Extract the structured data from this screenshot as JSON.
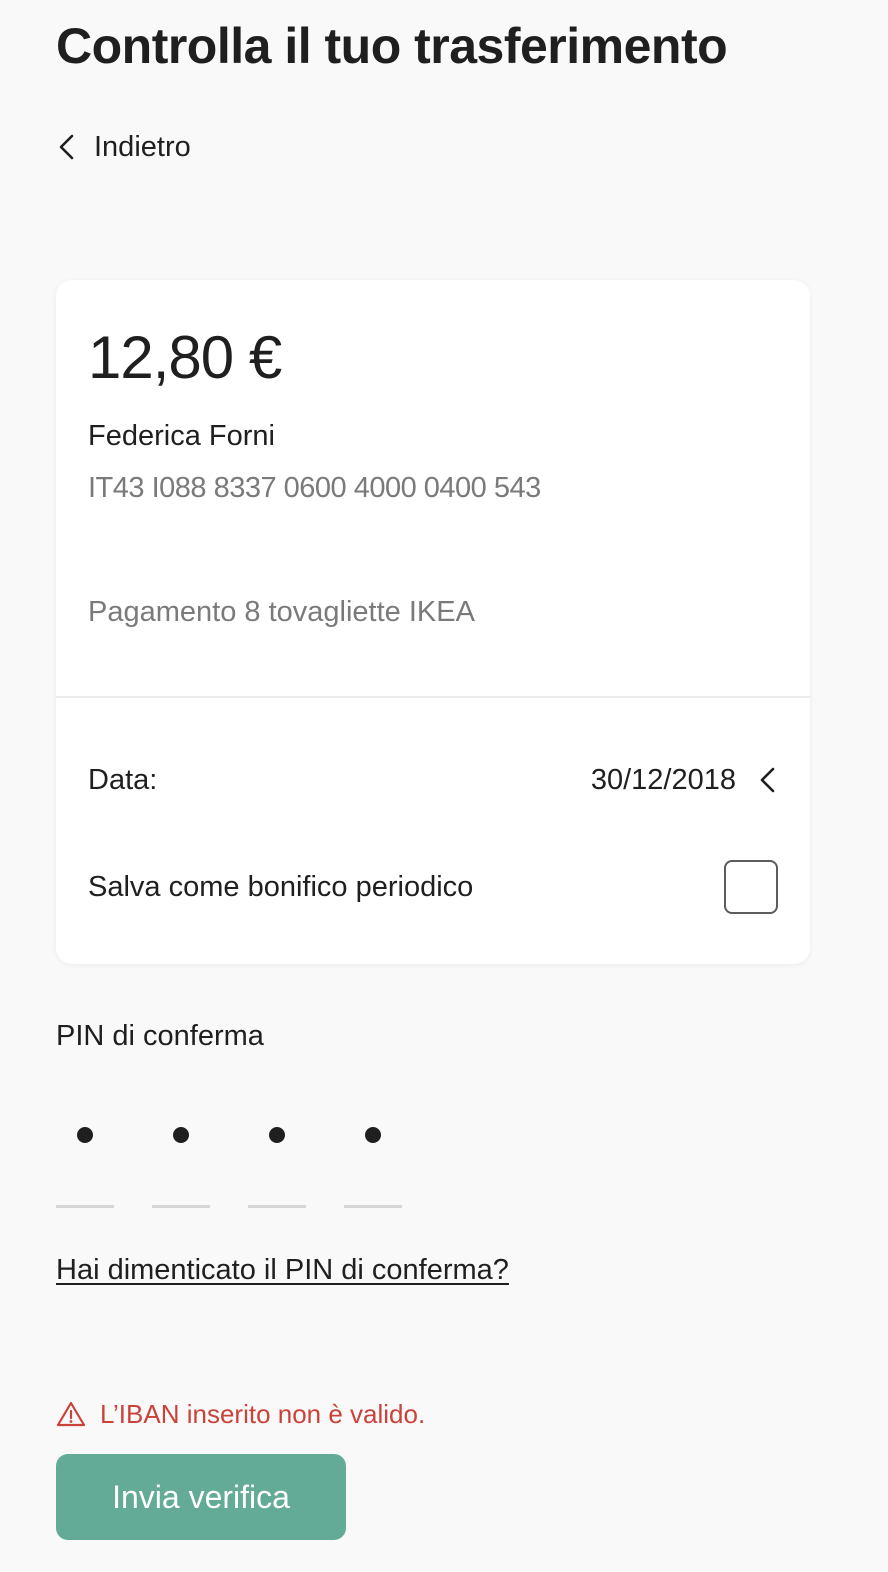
{
  "header": {
    "title": "Controlla il tuo trasferimento"
  },
  "nav": {
    "back_label": "Indietro",
    "back_icon": "chevron-left-icon"
  },
  "transfer": {
    "amount": "12,80 €",
    "beneficiary": "Federica Forni",
    "iban": "IT43 I088 8337 0600 4000 0400 543",
    "causale": "Pagamento 8 tovagliette IKEA"
  },
  "details": {
    "date_label": "Data:",
    "date_value": "30/12/2018",
    "date_icon": "chevron-left-icon",
    "periodic_label": "Salva come bonifico periodico",
    "periodic_checked": false
  },
  "pin": {
    "label": "PIN di conferma",
    "digits_filled": 4,
    "digits_total": 4,
    "forgot_link": "Hai dimenticato il PIN di conferma?"
  },
  "error": {
    "icon": "warning-icon",
    "message": "L’IBAN inserito non è valido.",
    "color": "#c9433b"
  },
  "actions": {
    "submit_label": "Invia verifica",
    "submit_color": "#63ab97"
  }
}
